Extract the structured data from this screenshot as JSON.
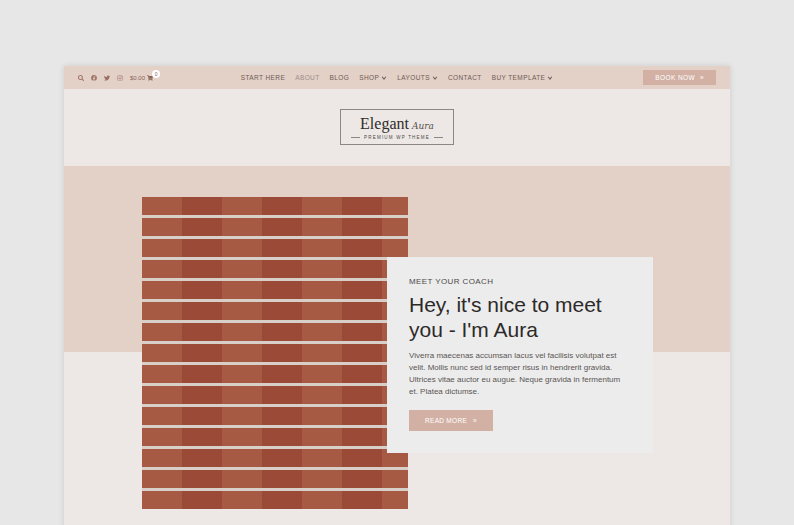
{
  "topbar": {
    "cart_total": "$0.00",
    "cart_count": "0",
    "nav": [
      {
        "label": "START HERE",
        "dropdown": false,
        "selected": false
      },
      {
        "label": "ABOUT",
        "dropdown": false,
        "selected": true
      },
      {
        "label": "BLOG",
        "dropdown": false,
        "selected": false
      },
      {
        "label": "SHOP",
        "dropdown": true,
        "selected": false
      },
      {
        "label": "LAYOUTS",
        "dropdown": true,
        "selected": false
      },
      {
        "label": "CONTACT",
        "dropdown": false,
        "selected": false
      },
      {
        "label": "BUY TEMPLATE",
        "dropdown": true,
        "selected": false
      }
    ],
    "button": {
      "label": "BOOK NOW",
      "icon": "»"
    }
  },
  "logo": {
    "word": "Elegant",
    "script": "Aura",
    "tagline": "PREMIUM WP THEME"
  },
  "hero": {
    "eyebrow": "MEET YOUR COACH",
    "title": "Hey, it's nice to meet you - I'm Aura",
    "body": "Viverra maecenas accumsan lacus vel facilisis volutpat est velit. Mollis nunc sed id semper risus in hendrerit gravida. Ultrices vitae auctor eu augue. Neque gravida in fermentum et. Platea dictumse.",
    "button": {
      "label": "READ MORE",
      "icon": "»"
    }
  }
}
